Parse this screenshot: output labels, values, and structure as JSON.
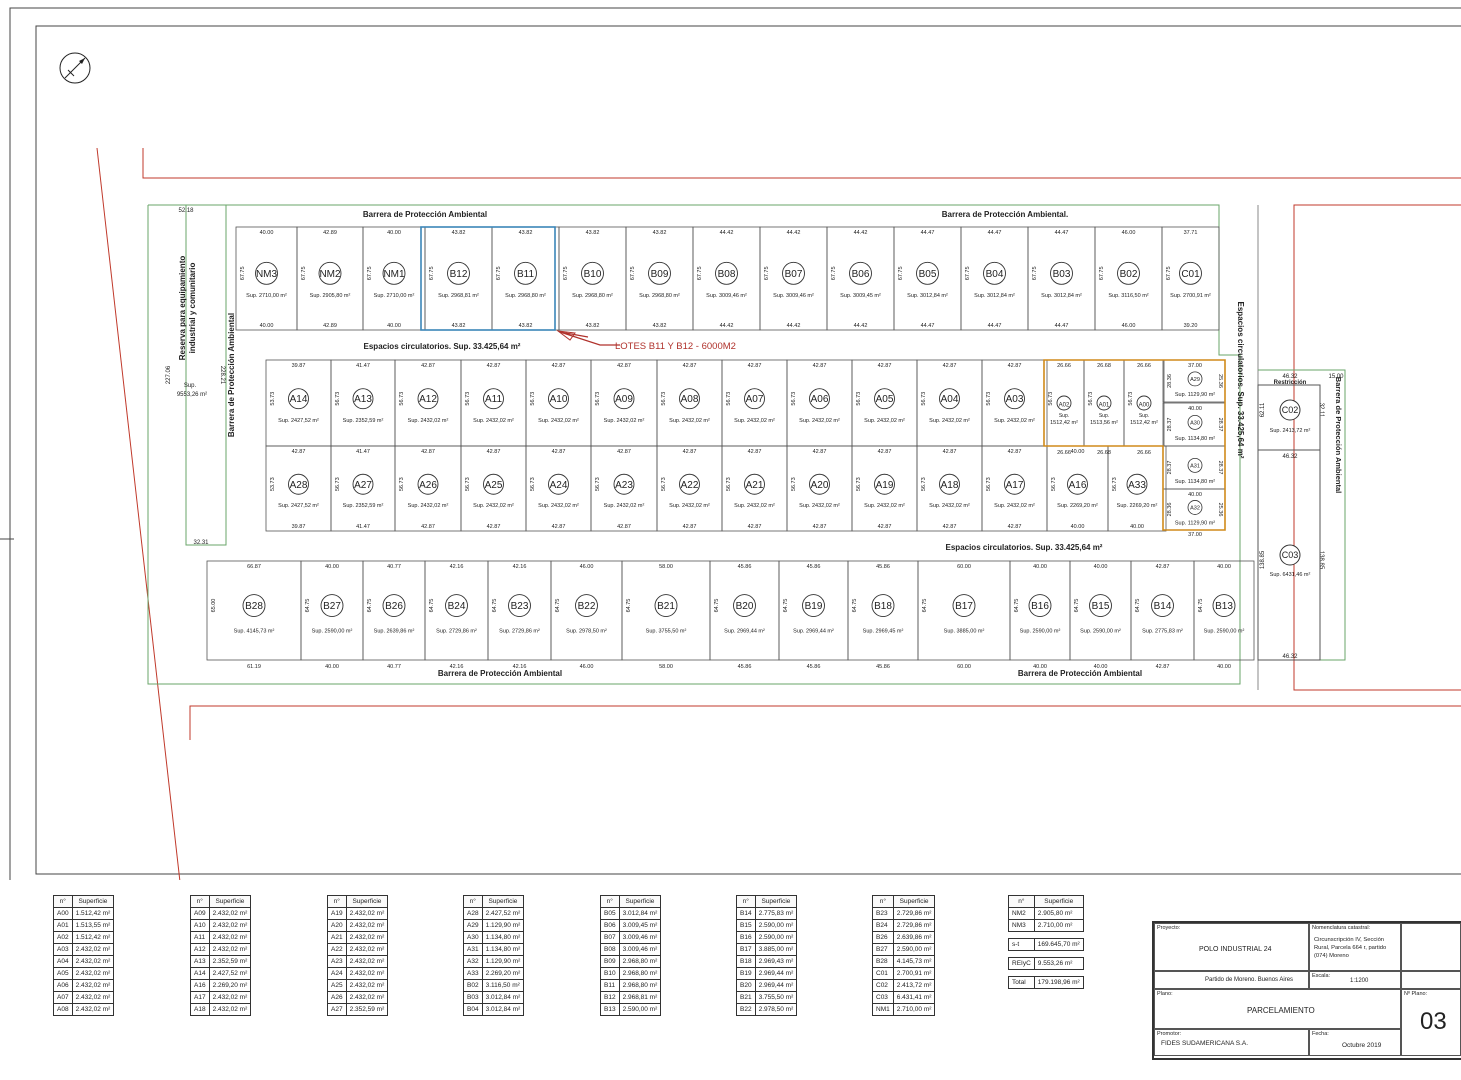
{
  "labels": {
    "barrier_top_left": "Barrera de Protección Ambiental",
    "barrier_top_right": "Barrera de Protección Ambiental.",
    "barrier_bottom_left": "Barrera de Protección Ambiental",
    "barrier_bottom_right": "Barrera de Protección Ambiental",
    "barrier_left": "Barrera de Protección Ambiental",
    "barrier_right": "Barrera de Protección Ambiental",
    "circ_top": "Espacios circulatorios.  Sup. 33.425,64 m²",
    "circ_bottom": "Espacios circulatorios.  Sup. 33.425,64 m²",
    "circ_right": "Espacios circulatorios.  Sup. 33.425,64 m²",
    "reserve_1": "Reserva para equipamiento",
    "reserve_2": "industrial y comunitario",
    "reserve_sup": "Sup.",
    "reserve_area": "9553,26 m²",
    "restriccion": "Restricción",
    "annotation": "LOTES B11 Y B12 - 6000M2",
    "dims": {
      "d5218": "52.18",
      "d3231": "32.31",
      "d22706": "227.06",
      "d22821": "228.21",
      "d4632": "46.32",
      "d1500": "15.00",
      "d6211": "62.11",
      "d3211": "32.11",
      "d13885a": "138.85",
      "d13885b": "138.85",
      "d4632b": "46.32",
      "d4632c": "46.32"
    }
  },
  "row_b_top": [
    {
      "id": "NM3",
      "sup": "Sup. 2710,00 m²",
      "top": "40.00",
      "bot": "40.00",
      "side": "67.75"
    },
    {
      "id": "NM2",
      "sup": "Sup. 2905,80 m²",
      "top": "42.89",
      "bot": "42.89",
      "side": "67.75"
    },
    {
      "id": "NM1",
      "sup": "Sup. 2710,00 m²",
      "top": "40.00",
      "bot": "40.00",
      "side": "67.75"
    },
    {
      "id": "B12",
      "sup": "Sup. 2968,81 m²",
      "top": "43.82",
      "bot": "43.82",
      "side": "67.75"
    },
    {
      "id": "B11",
      "sup": "Sup. 2968,80 m²",
      "top": "43.82",
      "bot": "43.82",
      "side": "67.75"
    },
    {
      "id": "B10",
      "sup": "Sup. 2968,80 m²",
      "top": "43.82",
      "bot": "43.82",
      "side": "67.75"
    },
    {
      "id": "B09",
      "sup": "Sup. 2968,80 m²",
      "top": "43.82",
      "bot": "43.82",
      "side": "67.75"
    },
    {
      "id": "B08",
      "sup": "Sup. 3009,46 m²",
      "top": "44.42",
      "bot": "44.42",
      "side": "67.75"
    },
    {
      "id": "B07",
      "sup": "Sup. 3009,46 m²",
      "top": "44.42",
      "bot": "44.42",
      "side": "67.75"
    },
    {
      "id": "B06",
      "sup": "Sup. 3009,45 m²",
      "top": "44.42",
      "bot": "44.42",
      "side": "67.75"
    },
    {
      "id": "B05",
      "sup": "Sup. 3012,84 m²",
      "top": "44.47",
      "bot": "44.47",
      "side": "67.75"
    },
    {
      "id": "B04",
      "sup": "Sup. 3012,84 m²",
      "top": "44.47",
      "bot": "44.47",
      "side": "67.75"
    },
    {
      "id": "B03",
      "sup": "Sup. 3012,84 m²",
      "top": "44.47",
      "bot": "44.47",
      "side": "67.75"
    },
    {
      "id": "B02",
      "sup": "Sup. 3116,50 m²",
      "top": "46.00",
      "bot": "46.00",
      "side": "67.75"
    },
    {
      "id": "C01",
      "sup": "Sup. 2700,91 m²",
      "top": "37.71",
      "bot": "39.20",
      "side": "67.75"
    }
  ],
  "row_a_top": [
    {
      "id": "A14",
      "sup": "Sup. 2427,52 m²",
      "top": "39.87",
      "side": "53.73"
    },
    {
      "id": "A13",
      "sup": "Sup. 2352,59 m²",
      "top": "41.47",
      "side": "56.73"
    },
    {
      "id": "A12",
      "sup": "Sup. 2432,02 m²",
      "top": "42.87",
      "side": "56.73"
    },
    {
      "id": "A11",
      "sup": "Sup. 2432,02 m²",
      "top": "42.87",
      "side": "56.73"
    },
    {
      "id": "A10",
      "sup": "Sup. 2432,02 m²",
      "top": "42.87",
      "side": "56.73"
    },
    {
      "id": "A09",
      "sup": "Sup. 2432,02 m²",
      "top": "42.87",
      "side": "56.73"
    },
    {
      "id": "A08",
      "sup": "Sup. 2432,02 m²",
      "top": "42.87",
      "side": "56.73"
    },
    {
      "id": "A07",
      "sup": "Sup. 2432,02 m²",
      "top": "42.87",
      "side": "56.73"
    },
    {
      "id": "A06",
      "sup": "Sup. 2432,02 m²",
      "top": "42.87",
      "side": "56.73"
    },
    {
      "id": "A05",
      "sup": "Sup. 2432,02 m²",
      "top": "42.87",
      "side": "56.73"
    },
    {
      "id": "A04",
      "sup": "Sup. 2432,02 m²",
      "top": "42.87",
      "side": "56.73"
    },
    {
      "id": "A03",
      "sup": "Sup. 2432,02 m²",
      "top": "42.87",
      "side": "56.73"
    }
  ],
  "row_a_bot": [
    {
      "id": "A28",
      "sup": "Sup. 2427,52 m²",
      "top": "42.87",
      "bot": "39.87",
      "side": "53.73"
    },
    {
      "id": "A27",
      "sup": "Sup. 2352,59 m²",
      "top": "41.47",
      "bot": "41.47",
      "side": "56.73"
    },
    {
      "id": "A26",
      "sup": "Sup. 2432,02 m²",
      "top": "42.87",
      "bot": "42.87",
      "side": "56.73"
    },
    {
      "id": "A25",
      "sup": "Sup. 2432,02 m²",
      "top": "42.87",
      "bot": "42.87",
      "side": "56.73"
    },
    {
      "id": "A24",
      "sup": "Sup. 2432,02 m²",
      "top": "42.87",
      "bot": "42.87",
      "side": "56.73"
    },
    {
      "id": "A23",
      "sup": "Sup. 2432,02 m²",
      "top": "42.87",
      "bot": "42.87",
      "side": "56.73"
    },
    {
      "id": "A22",
      "sup": "Sup. 2432,02 m²",
      "top": "42.87",
      "bot": "42.87",
      "side": "56.73"
    },
    {
      "id": "A21",
      "sup": "Sup. 2432,02 m²",
      "top": "42.87",
      "bot": "42.87",
      "side": "56.73"
    },
    {
      "id": "A20",
      "sup": "Sup. 2432,02 m²",
      "top": "42.87",
      "bot": "42.87",
      "side": "56.73"
    },
    {
      "id": "A19",
      "sup": "Sup. 2432,02 m²",
      "top": "42.87",
      "bot": "42.87",
      "side": "56.73"
    },
    {
      "id": "A18",
      "sup": "Sup. 2432,02 m²",
      "top": "42.87",
      "bot": "42.87",
      "side": "56.73"
    },
    {
      "id": "A17",
      "sup": "Sup. 2432,02 m²",
      "top": "42.87",
      "bot": "42.87",
      "side": "56.73"
    },
    {
      "id": "A16",
      "sup": "Sup. 2269,20 m²",
      "top": "40.00",
      "bot": "40.00",
      "side": "56.73"
    },
    {
      "id": "A33",
      "sup": "Sup. 2269,20 m²",
      "top": "",
      "bot": "40.00",
      "side": "56.73"
    }
  ],
  "small_lots": [
    {
      "id": "A02",
      "sup1": "Sup.",
      "sup2": "1512,42 m²",
      "top": "26.66",
      "bot": "26.66",
      "side": "56.73"
    },
    {
      "id": "A01",
      "sup1": "Sup.",
      "sup2": "1513,56 m²",
      "top": "26.68",
      "bot": "26.68",
      "side": "56.73"
    },
    {
      "id": "A00",
      "sup1": "Sup.",
      "sup2": "1512,42 m²",
      "top": "26.66",
      "bot": "26.66",
      "side": "56.73"
    }
  ],
  "right_lots": [
    {
      "id": "A29",
      "sup": "Sup. 1129,90 m²",
      "top": "37.00",
      "side": "28.36",
      "rside": "25.36"
    },
    {
      "id": "A30",
      "sup": "Sup. 1134,80 m²",
      "top": "40.00",
      "side": "28.37",
      "rside": "28.37"
    },
    {
      "id": "A31",
      "sup": "Sup. 1134,80 m²",
      "top": "",
      "side": "28.37",
      "rside": "28.37"
    },
    {
      "id": "A32",
      "sup": "Sup. 1129,90 m²",
      "top": "40.00",
      "bot": "37.00",
      "side": "28.36",
      "rside": "25.36"
    }
  ],
  "c02": {
    "id": "C02",
    "sup": "Sup. 2413,72 m²"
  },
  "c03": {
    "id": "C03",
    "sup": "Sup. 6431,46 m²"
  },
  "row_b_bot": [
    {
      "id": "B28",
      "sup": "Sup. 4145,73 m²",
      "top": "66.87",
      "bot": "61.19",
      "side": "65.00"
    },
    {
      "id": "B27",
      "sup": "Sup. 2590,00 m²",
      "top": "40.00",
      "bot": "40.00",
      "side": "64.75"
    },
    {
      "id": "B26",
      "sup": "Sup. 2639,86 m²",
      "top": "40.77",
      "bot": "40.77",
      "side": "64.75"
    },
    {
      "id": "B24",
      "sup": "Sup. 2729,86 m²",
      "top": "42.16",
      "bot": "42.16",
      "side": "64.75"
    },
    {
      "id": "B23",
      "sup": "Sup. 2729,86 m²",
      "top": "42.16",
      "bot": "42.16",
      "side": "64.75"
    },
    {
      "id": "B22",
      "sup": "Sup. 2978,50 m²",
      "top": "46.00",
      "bot": "46.00",
      "side": "64.75"
    },
    {
      "id": "B21",
      "sup": "Sup. 3755,50 m²",
      "top": "58.00",
      "bot": "58.00",
      "side": "64.75"
    },
    {
      "id": "B20",
      "sup": "Sup. 2969,44 m²",
      "top": "45.86",
      "bot": "45.86",
      "side": "64.75"
    },
    {
      "id": "B19",
      "sup": "Sup. 2969,44 m²",
      "top": "45.86",
      "bot": "45.86",
      "side": "64.75"
    },
    {
      "id": "B18",
      "sup": "Sup. 2969,45 m²",
      "top": "45.86",
      "bot": "45.86",
      "side": "64.75"
    },
    {
      "id": "B17",
      "sup": "Sup. 3885,00 m²",
      "top": "60.00",
      "bot": "60.00",
      "side": "64.75"
    },
    {
      "id": "B16",
      "sup": "Sup. 2590,00 m²",
      "top": "40.00",
      "bot": "40.00",
      "side": "64.75"
    },
    {
      "id": "B15",
      "sup": "Sup. 2590,00 m²",
      "top": "40.00",
      "bot": "40.00",
      "side": "64.75"
    },
    {
      "id": "B14",
      "sup": "Sup. 2775,83 m²",
      "top": "42.87",
      "bot": "42.87",
      "side": "64.75"
    },
    {
      "id": "B13",
      "sup": "Sup. 2590,00 m²",
      "top": "40.00",
      "bot": "40.00",
      "side": "64.75"
    }
  ],
  "tables": [
    {
      "h1": "n°",
      "h2": "Superficie",
      "rows": [
        [
          "A00",
          "1.512,42 m²"
        ],
        [
          "A01",
          "1.513,55 m²"
        ],
        [
          "A02",
          "1.512,42 m²"
        ],
        [
          "A03",
          "2.432,02 m²"
        ],
        [
          "A04",
          "2.432,02 m²"
        ],
        [
          "A05",
          "2.432,02 m²"
        ],
        [
          "A06",
          "2.432,02 m²"
        ],
        [
          "A07",
          "2.432,02 m²"
        ],
        [
          "A08",
          "2.432,02 m²"
        ]
      ]
    },
    {
      "h1": "n°",
      "h2": "Superficie",
      "rows": [
        [
          "A09",
          "2.432,02 m²"
        ],
        [
          "A10",
          "2.432,02 m²"
        ],
        [
          "A11",
          "2.432,02 m²"
        ],
        [
          "A12",
          "2.432,02 m²"
        ],
        [
          "A13",
          "2.352,59 m²"
        ],
        [
          "A14",
          "2.427,52 m²"
        ],
        [
          "A16",
          "2.269,20 m²"
        ],
        [
          "A17",
          "2.432,02 m²"
        ],
        [
          "A18",
          "2.432,02 m²"
        ]
      ]
    },
    {
      "h1": "n°",
      "h2": "Superficie",
      "rows": [
        [
          "A19",
          "2.432,02 m²"
        ],
        [
          "A20",
          "2.432,02 m²"
        ],
        [
          "A21",
          "2.432,02 m²"
        ],
        [
          "A22",
          "2.432,02 m²"
        ],
        [
          "A23",
          "2.432,02 m²"
        ],
        [
          "A24",
          "2.432,02 m²"
        ],
        [
          "A25",
          "2.432,02 m²"
        ],
        [
          "A26",
          "2.432,02 m²"
        ],
        [
          "A27",
          "2.352,59 m²"
        ]
      ]
    },
    {
      "h1": "n°",
      "h2": "Superficie",
      "rows": [
        [
          "A28",
          "2.427,52 m²"
        ],
        [
          "A29",
          "1.129,90 m²"
        ],
        [
          "A30",
          "1.134,80 m²"
        ],
        [
          "A31",
          "1.134,80 m²"
        ],
        [
          "A32",
          "1.129,90 m²"
        ],
        [
          "A33",
          "2.269,20 m²"
        ],
        [
          "B02",
          "3.116,50 m²"
        ],
        [
          "B03",
          "3.012,84 m²"
        ],
        [
          "B04",
          "3.012,84 m²"
        ]
      ]
    },
    {
      "h1": "n°",
      "h2": "Superficie",
      "rows": [
        [
          "B05",
          "3.012,84 m²"
        ],
        [
          "B06",
          "3.009,45 m²"
        ],
        [
          "B07",
          "3.009,46 m²"
        ],
        [
          "B08",
          "3.009,46 m²"
        ],
        [
          "B09",
          "2.968,80 m²"
        ],
        [
          "B10",
          "2.968,80 m²"
        ],
        [
          "B11",
          "2.968,80 m²"
        ],
        [
          "B12",
          "2.968,81 m²"
        ],
        [
          "B13",
          "2.590,00 m²"
        ]
      ]
    },
    {
      "h1": "n°",
      "h2": "Superficie",
      "rows": [
        [
          "B14",
          "2.775,83 m²"
        ],
        [
          "B15",
          "2.590,00 m²"
        ],
        [
          "B16",
          "2.590,00 m²"
        ],
        [
          "B17",
          "3.885,00 m²"
        ],
        [
          "B18",
          "2.969,43 m²"
        ],
        [
          "B19",
          "2.969,44 m²"
        ],
        [
          "B20",
          "2.969,44 m²"
        ],
        [
          "B21",
          "3.755,50 m²"
        ],
        [
          "B22",
          "2.978,50 m²"
        ]
      ]
    },
    {
      "h1": "n°",
      "h2": "Superficie",
      "rows": [
        [
          "B23",
          "2.729,86 m²"
        ],
        [
          "B24",
          "2.729,86 m²"
        ],
        [
          "B26",
          "2.639,86 m²"
        ],
        [
          "B27",
          "2.590,00 m²"
        ],
        [
          "B28",
          "4.145,73 m²"
        ],
        [
          "C01",
          "2.700,91 m²"
        ],
        [
          "C02",
          "2.413,72 m²"
        ],
        [
          "C03",
          "6.431,41 m²"
        ],
        [
          "NM1",
          "2.710,00 m²"
        ]
      ]
    }
  ],
  "summary": {
    "h1": "n°",
    "h2": "Superficie",
    "rows": [
      [
        "NM2",
        "2.905,80 m²"
      ],
      [
        "NM3",
        "2.710,00 m²"
      ]
    ],
    "st_label": "s-t",
    "st_value": "169.645,70 m²",
    "re_label": "REIyC",
    "re_value": "9.553,26 m²",
    "tot_label": "Total",
    "tot_value": "179.198,96 m²"
  },
  "title_block": {
    "proyecto_label": "Proyecto:",
    "proyecto": "POLO INDUSTRIAL 24",
    "nomen_label": "Nomenclatura catastral:",
    "nomen": "Circunscripción IV, Sección Rural, Parcela 664 r, partido (074) Moreno",
    "location": "Partido de Moreno. Buenos Aires",
    "escala_label": "Escala:",
    "escala": "1:1200",
    "plano_label": "Plano:",
    "plano": "PARCELAMIENTO",
    "nplano_label": "Nº Plano:",
    "nplano": "03",
    "promotor_label": "Promotor:",
    "promotor": "FIDES SUDAMERICANA S.A.",
    "fecha_label": "Fecha:",
    "fecha": "Octubre 2019"
  },
  "colors": {
    "line": "#333333",
    "green": "#6aa56a",
    "blue": "#3b86b8",
    "orange": "#d08a1a",
    "red": "#c0392b",
    "red_annot": "#b0322c"
  }
}
